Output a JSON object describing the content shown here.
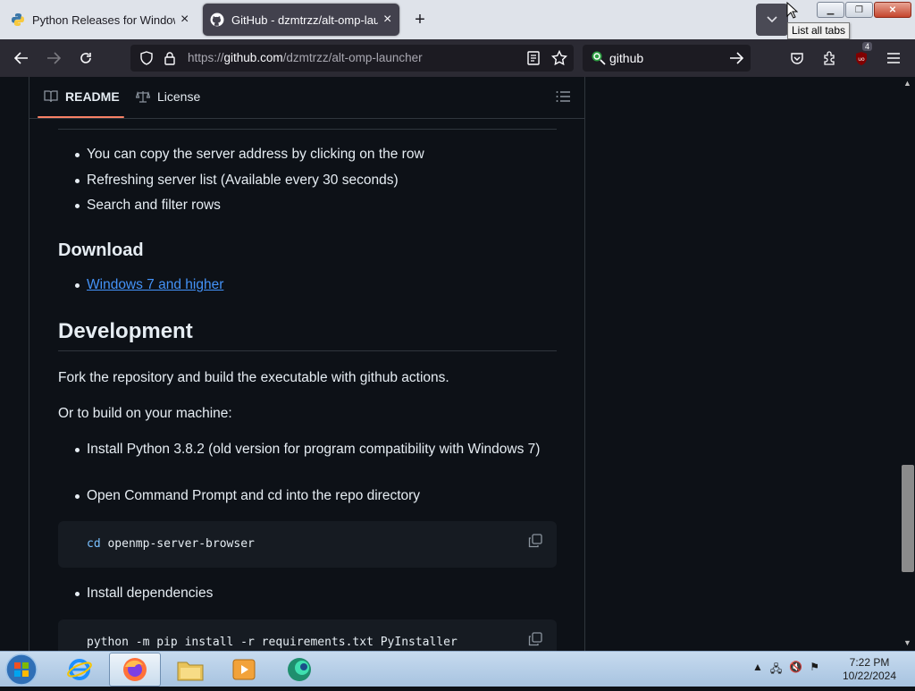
{
  "browser": {
    "tabs": [
      {
        "title": "Python Releases for Windows |",
        "active": false,
        "favicon": "python-icon"
      },
      {
        "title": "GitHub - dzmtrzz/alt-omp-launcher",
        "active": true,
        "favicon": "github-icon"
      }
    ],
    "new_tab_label": "+",
    "list_tabs_tooltip": "List all tabs",
    "url_prefix": "https://",
    "url_host": "github.com",
    "url_path": "/dzmtrzz/alt-omp-launcher",
    "search_text": "github",
    "extension_badge": "4"
  },
  "readme": {
    "tabs": [
      {
        "label": "README",
        "icon": "book-icon",
        "active": true
      },
      {
        "label": "License",
        "icon": "scale-icon",
        "active": false
      }
    ],
    "features": [
      "You can copy the server address by clicking on the row",
      "Refreshing server list (Available every 30 seconds)",
      "Search and filter rows"
    ],
    "download_heading": "Download",
    "download_link": "Windows 7 and higher",
    "development_heading": "Development",
    "fork_text": "Fork the repository and build the executable with github actions.",
    "build_intro": "Or to build on your machine:",
    "steps": [
      "Install Python 3.8.2 (old version for program compatibility with Windows 7)",
      "Open Command Prompt and cd into the repo directory"
    ],
    "code1_kw": "cd",
    "code1_rest": " openmp-server-browser",
    "step3": "Install dependencies",
    "code2": "python -m pip install -r requirements.txt PyInstaller"
  },
  "taskbar": {
    "time": "7:22 PM",
    "date": "10/22/2024",
    "apps": [
      "internet-explorer-icon",
      "firefox-icon",
      "file-explorer-icon",
      "media-player-icon",
      "app-icon"
    ]
  }
}
